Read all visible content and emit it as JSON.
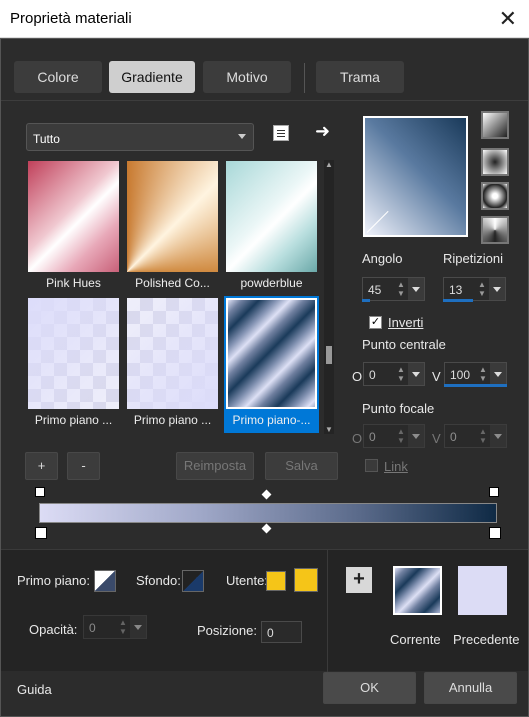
{
  "window": {
    "title": "Proprietà materiali"
  },
  "tabs": [
    {
      "label": "Colore",
      "active": false
    },
    {
      "label": "Gradiente",
      "active": true
    },
    {
      "label": "Motivo",
      "active": false
    },
    {
      "label": "Trama",
      "active": false
    }
  ],
  "library": {
    "category": "Tutto",
    "items": [
      {
        "caption": "Pink Hues"
      },
      {
        "caption": "Polished Co..."
      },
      {
        "caption": "powderblue"
      },
      {
        "caption": "Primo piano ..."
      },
      {
        "caption": "Primo piano ..."
      },
      {
        "caption": "Primo piano-..."
      }
    ],
    "add_label": "+",
    "remove_label": "-",
    "reset_label": "Reimposta",
    "save_label": "Salva"
  },
  "settings": {
    "angle_label": "Angolo",
    "angle": "45",
    "repeats_label": "Ripetizioni",
    "repeats": "13",
    "invert_label": "Inverti",
    "invert_checked": true,
    "center_label": "Punto centrale",
    "center_o_label": "O",
    "center_o": "0",
    "center_v_label": "V",
    "center_v": "100",
    "focal_label": "Punto focale",
    "focal_o_label": "O",
    "focal_o": "0",
    "focal_v_label": "V",
    "focal_v": "0",
    "link_label": "Link"
  },
  "bottom": {
    "foreground_label": "Primo piano:",
    "background_label": "Sfondo:",
    "user_label": "Utente:",
    "opacity_label": "Opacità:",
    "opacity": "0",
    "position_label": "Posizione:",
    "position": "0",
    "current_label": "Corrente",
    "previous_label": "Precedente",
    "user_color": "#f5c518"
  },
  "footer": {
    "help_label": "Guida",
    "ok_label": "OK",
    "cancel_label": "Annulla"
  }
}
